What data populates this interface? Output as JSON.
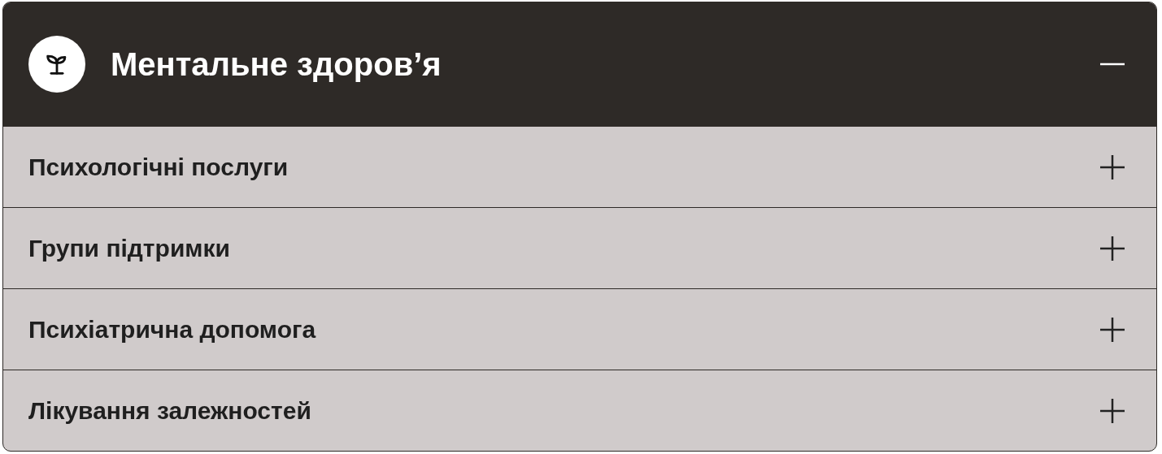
{
  "section": {
    "title": "Ментальне здоров’я",
    "expanded": true
  },
  "items": [
    {
      "label": "Психологічні послуги",
      "expanded": false
    },
    {
      "label": "Групи підтримки",
      "expanded": false
    },
    {
      "label": "Психіатрична допомога",
      "expanded": false
    },
    {
      "label": "Лікування залежностей",
      "expanded": false
    }
  ]
}
